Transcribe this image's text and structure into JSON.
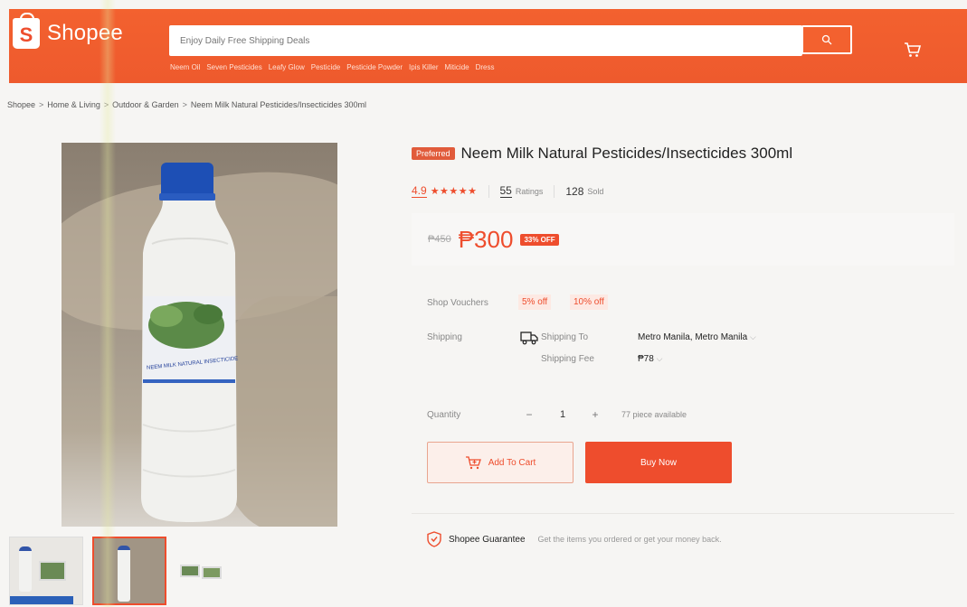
{
  "header": {
    "logo_text": "Shopee",
    "logo_letter": "S",
    "search_placeholder": "Enjoy Daily Free Shipping Deals",
    "suggestions": [
      "Neem Oil",
      "Seven Pesticides",
      "Leafy Glow",
      "Pesticide",
      "Pesticide Powder",
      "Ipis Killer",
      "Miticide",
      "Dress"
    ]
  },
  "breadcrumb": [
    "Shopee",
    "Home & Living",
    "Outdoor & Garden",
    "Neem Milk Natural Pesticides/Insecticides 300ml"
  ],
  "product": {
    "badge": "Preferred",
    "title": "Neem Milk Natural Pesticides/Insecticides 300ml",
    "rating": "4.9",
    "stars": "★★★★★",
    "ratings_count": "55",
    "ratings_label": "Ratings",
    "sold_count": "128",
    "sold_label": "Sold",
    "old_price": "₱450",
    "price": "₱300",
    "discount": "33% OFF",
    "label_text": "NEEM MILK NATURAL INSECTICIDE"
  },
  "vouchers": {
    "label": "Shop Vouchers",
    "items": [
      "5% off",
      "10% off"
    ]
  },
  "shipping": {
    "label": "Shipping",
    "to_label": "Shipping To",
    "to_value": "Metro Manila, Metro Manila",
    "fee_label": "Shipping Fee",
    "fee_value": "₱78"
  },
  "quantity": {
    "label": "Quantity",
    "minus": "−",
    "value": "1",
    "plus": "+",
    "available": "77 piece available"
  },
  "actions": {
    "add_to_cart": "Add To Cart",
    "buy_now": "Buy Now"
  },
  "guarantee": {
    "title": "Shopee Guarantee",
    "text": "Get the items you ordered or get your money back."
  },
  "colors": {
    "brand": "#ee4d2d",
    "header": "#f3612f"
  }
}
